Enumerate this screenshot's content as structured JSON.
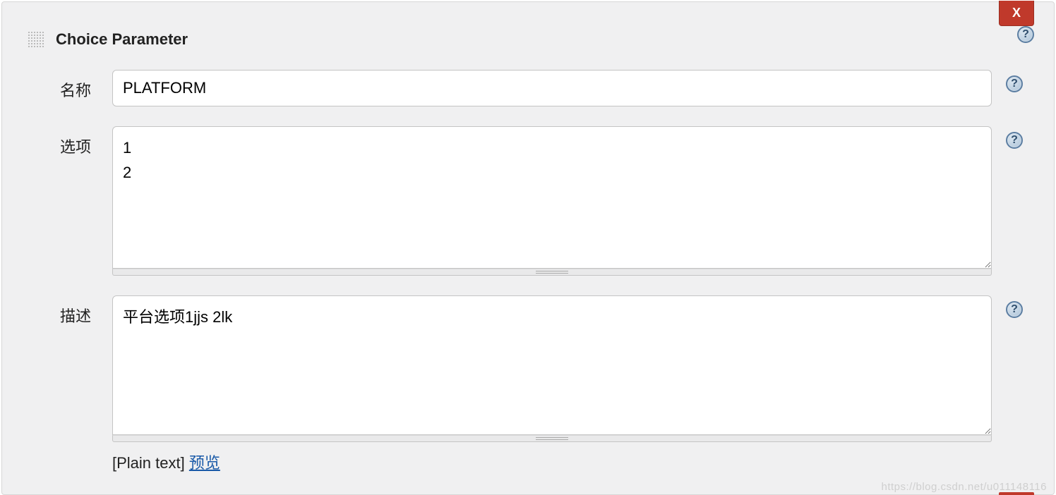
{
  "section_title": "Choice Parameter",
  "close_label": "X",
  "name": {
    "label": "名称",
    "value": "PLATFORM"
  },
  "options": {
    "label": "选项",
    "value": "1\n2"
  },
  "description": {
    "label": "描述",
    "value": "平台选项1jjs 2lk"
  },
  "footer": {
    "plain_text": "[Plain text]",
    "preview": "预览"
  },
  "watermark": "https://blog.csdn.net/u011148116",
  "help_glyph": "?"
}
